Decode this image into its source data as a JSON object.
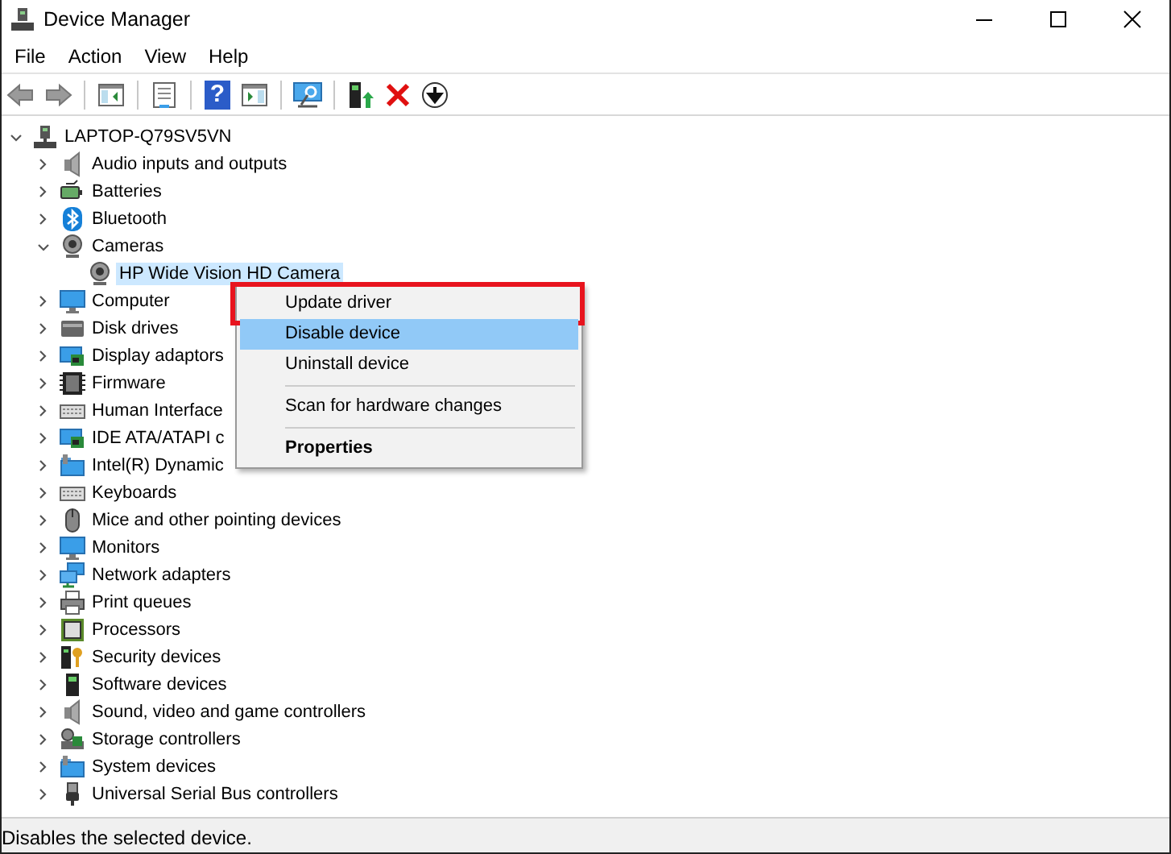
{
  "window": {
    "title": "Device Manager"
  },
  "menu_bar": [
    "File",
    "Action",
    "View",
    "Help"
  ],
  "toolbar": [
    {
      "kind": "back"
    },
    {
      "kind": "forward"
    },
    {
      "kind": "tree-pane",
      "separator_before": true
    },
    {
      "kind": "properties",
      "separator_before": true
    },
    {
      "kind": "help",
      "glyph": "?",
      "separator_before": true
    },
    {
      "kind": "action-pane"
    },
    {
      "kind": "scan",
      "separator_before": true
    },
    {
      "kind": "update",
      "separator_before": true
    },
    {
      "kind": "uninstall"
    },
    {
      "kind": "disable"
    }
  ],
  "tree": [
    {
      "label": "LAPTOP-Q79SV5VN",
      "kind": "computer",
      "expanded": true,
      "selected": false,
      "children": [
        {
          "label": "Audio inputs and outputs",
          "kind": "speaker",
          "expanded": false,
          "selected": false
        },
        {
          "label": "Batteries",
          "kind": "battery",
          "expanded": false,
          "selected": false
        },
        {
          "label": "Bluetooth",
          "kind": "bluetooth",
          "expanded": false,
          "selected": false
        },
        {
          "label": "Cameras",
          "kind": "webcam",
          "expanded": true,
          "selected": false,
          "children": [
            {
              "label": "HP Wide Vision HD Camera",
              "kind": "webcam",
              "selected": true
            }
          ]
        },
        {
          "label": "Computer",
          "kind": "monitor",
          "expanded": false,
          "selected": false
        },
        {
          "label": "Disk drives",
          "kind": "drive",
          "expanded": false,
          "selected": false
        },
        {
          "label": "Display adaptors",
          "kind": "card",
          "expanded": false,
          "selected": false
        },
        {
          "label": "Firmware",
          "kind": "chip",
          "expanded": false,
          "selected": false
        },
        {
          "label": "Human Interface",
          "kind": "keyboard",
          "expanded": false,
          "selected": false
        },
        {
          "label": "IDE ATA/ATAPI c",
          "kind": "card",
          "expanded": false,
          "selected": false
        },
        {
          "label": "Intel(R) Dynamic",
          "kind": "folder",
          "expanded": false,
          "selected": false
        },
        {
          "label": "Keyboards",
          "kind": "keyboard",
          "expanded": false,
          "selected": false
        },
        {
          "label": "Mice and other pointing devices",
          "kind": "mouse",
          "expanded": false,
          "selected": false
        },
        {
          "label": "Monitors",
          "kind": "monitor",
          "expanded": false,
          "selected": false
        },
        {
          "label": "Network adapters",
          "kind": "network",
          "expanded": false,
          "selected": false
        },
        {
          "label": "Print queues",
          "kind": "printer",
          "expanded": false,
          "selected": false
        },
        {
          "label": "Processors",
          "kind": "processor",
          "expanded": false,
          "selected": false
        },
        {
          "label": "Security devices",
          "kind": "key",
          "expanded": false,
          "selected": false
        },
        {
          "label": "Software devices",
          "kind": "tower",
          "expanded": false,
          "selected": false
        },
        {
          "label": "Sound, video and game controllers",
          "kind": "speaker",
          "expanded": false,
          "selected": false
        },
        {
          "label": "Storage controllers",
          "kind": "storage",
          "expanded": false,
          "selected": false
        },
        {
          "label": "System devices",
          "kind": "folder",
          "expanded": false,
          "selected": false
        },
        {
          "label": "Universal Serial Bus controllers",
          "kind": "usb",
          "expanded": false,
          "selected": false
        }
      ]
    }
  ],
  "context_menu": [
    {
      "label": "Update driver",
      "highlighted": false,
      "outlined": true,
      "bold": false,
      "separator_before": false
    },
    {
      "label": "Disable device",
      "highlighted": true,
      "outlined": false,
      "bold": false,
      "separator_before": false
    },
    {
      "label": "Uninstall device",
      "highlighted": false,
      "outlined": false,
      "bold": false,
      "separator_before": false
    },
    {
      "label": "Scan for hardware changes",
      "highlighted": false,
      "outlined": false,
      "bold": false,
      "separator_before": true
    },
    {
      "label": "Properties",
      "highlighted": false,
      "outlined": false,
      "bold": true,
      "separator_before": true
    }
  ],
  "status_bar": "Disables the selected device."
}
